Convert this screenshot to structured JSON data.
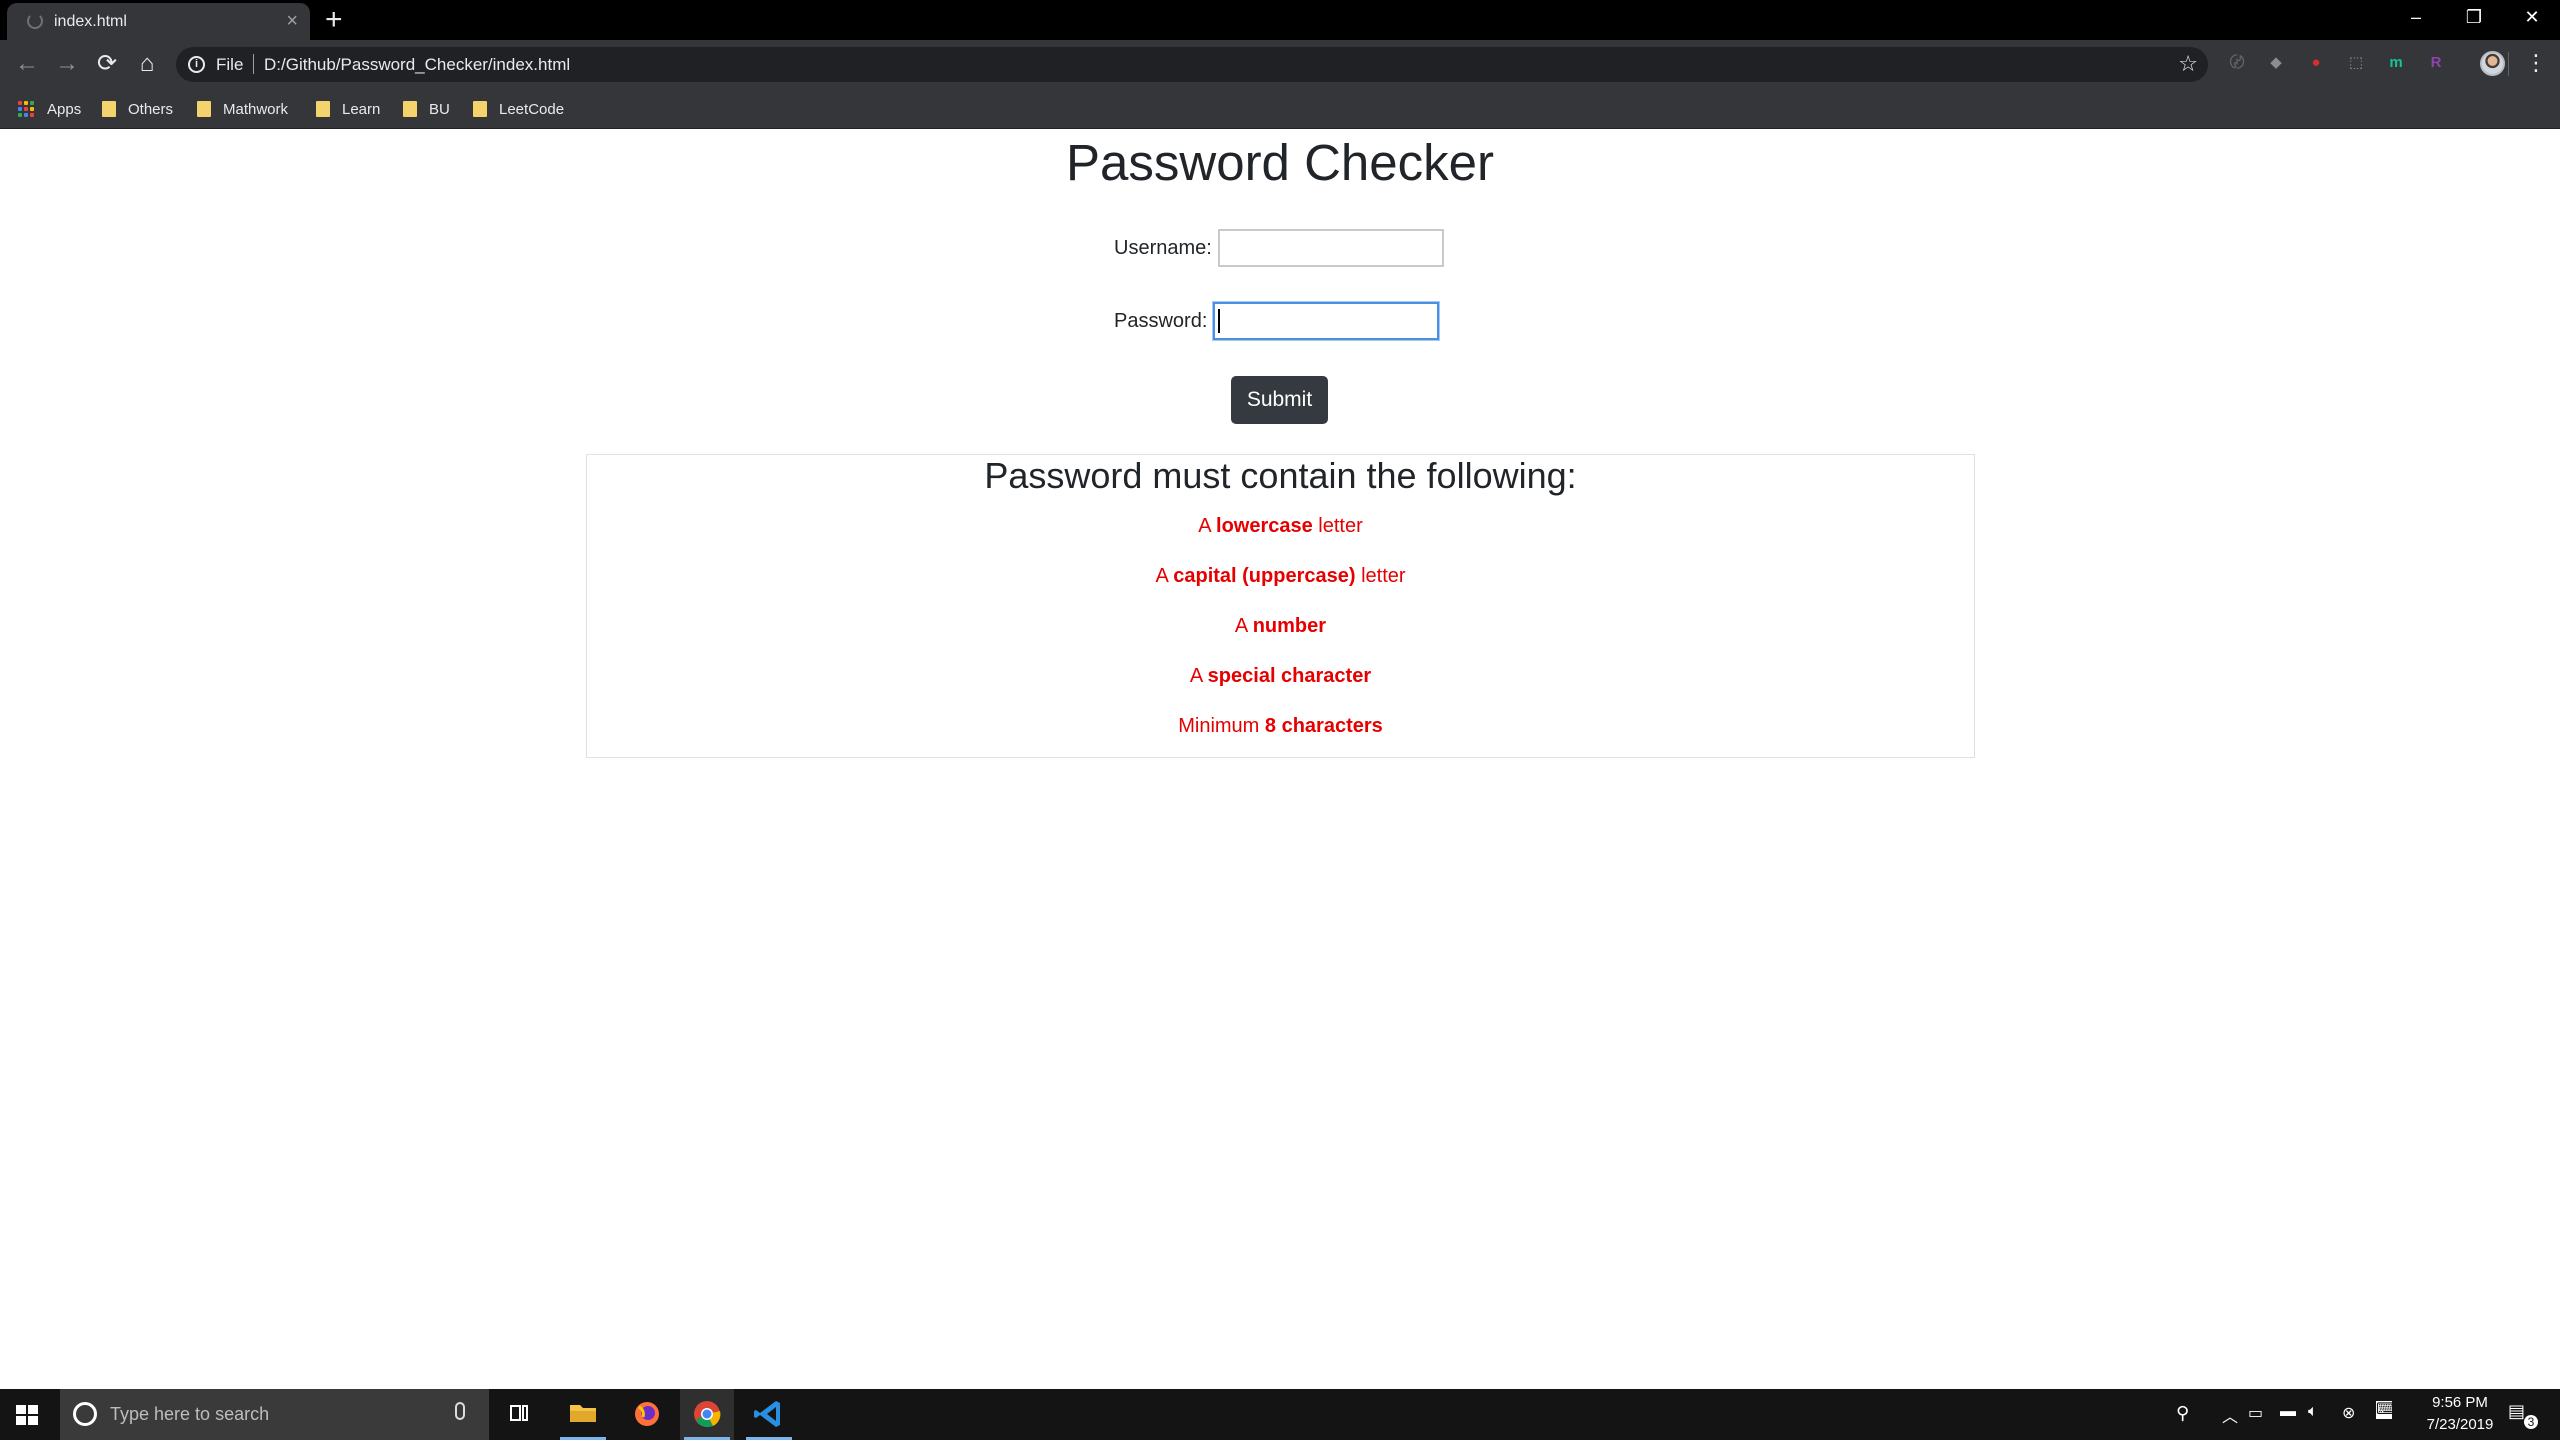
{
  "browser": {
    "tab_title": "index.html",
    "tab_close": "×",
    "new_tab": "+",
    "window_controls": {
      "minimize": "–",
      "restore": "❐",
      "close": "✕"
    },
    "nav": {
      "back": "←",
      "forward": "→",
      "reload": "⟳",
      "home": "⌂"
    },
    "omnibox": {
      "info": "i",
      "scheme": "File",
      "url": "D:/Github/Password_Checker/index.html",
      "star": "☆"
    },
    "extensions": [
      {
        "name": "rss-extension-icon",
        "glyph": "〄",
        "color": "#5f6368"
      },
      {
        "name": "layers-extension-icon",
        "glyph": "◆",
        "color": "#8a8d91"
      },
      {
        "name": "lastpass-extension-icon",
        "glyph": "●",
        "color": "#d32f2f"
      },
      {
        "name": "pdf-extension-icon",
        "glyph": "⬚",
        "color": "#8a8d91"
      },
      {
        "name": "grammarly-extension-icon",
        "glyph": "m",
        "color": "#15c39a"
      },
      {
        "name": "r-extension-icon",
        "glyph": "R",
        "color": "#8e44ad"
      }
    ],
    "menu": "⋮"
  },
  "bookmarks": [
    {
      "label": "Apps",
      "type": "apps"
    },
    {
      "label": "Others",
      "type": "folder"
    },
    {
      "label": "Mathwork",
      "type": "folder"
    },
    {
      "label": "Learn",
      "type": "folder"
    },
    {
      "label": "BU",
      "type": "folder"
    },
    {
      "label": "LeetCode",
      "type": "folder"
    }
  ],
  "page": {
    "title": "Password Checker",
    "username_label": "Username:",
    "username_value": "",
    "password_label": "Password:",
    "password_value": "",
    "submit_label": "Submit",
    "requirements_heading": "Password must contain the following:",
    "requirements": [
      {
        "prefix": "A ",
        "bold": "lowercase",
        "suffix": " letter"
      },
      {
        "prefix": "A ",
        "bold": "capital (uppercase)",
        "suffix": " letter"
      },
      {
        "prefix": "A ",
        "bold": "number",
        "suffix": ""
      },
      {
        "prefix": "A ",
        "bold": "special character",
        "suffix": ""
      },
      {
        "prefix": "Minimum ",
        "bold": "8 characters",
        "suffix": ""
      }
    ],
    "invalid_color": "#e60000"
  },
  "taskbar": {
    "search_placeholder": "Type here to search",
    "time": "9:56 PM",
    "date": "7/23/2019",
    "notification_count": "3"
  }
}
